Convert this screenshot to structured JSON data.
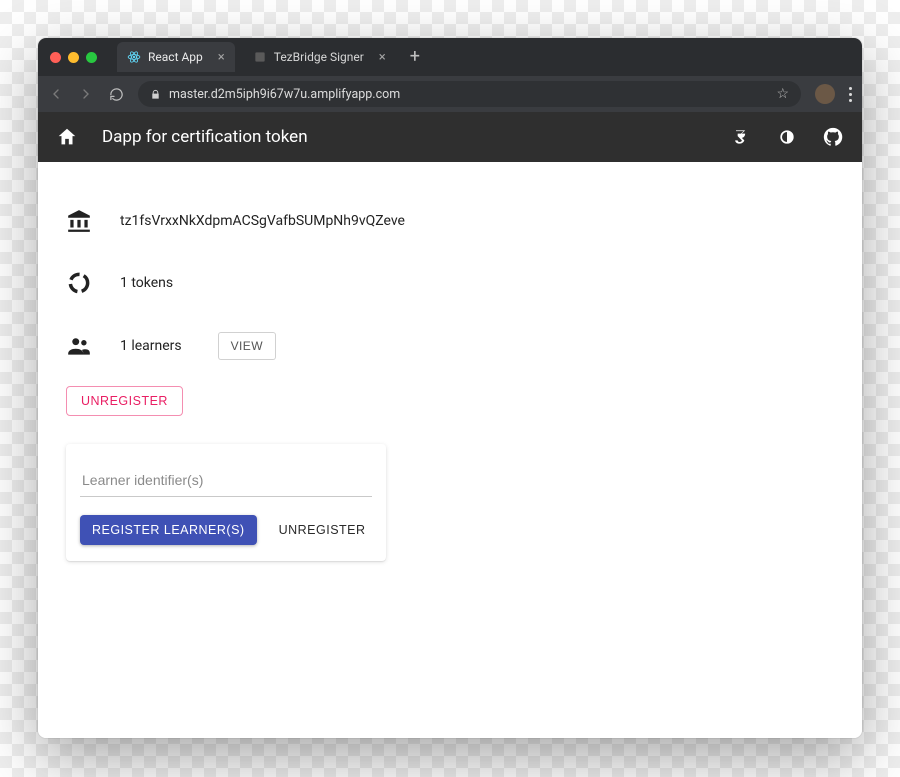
{
  "browser": {
    "tabs": [
      {
        "label": "React App",
        "active": true
      },
      {
        "label": "TezBridge Signer",
        "active": false
      }
    ],
    "url": "master.d2m5iph9i67w7u.amplifyapp.com"
  },
  "appbar": {
    "title": "Dapp for certification token"
  },
  "account": {
    "address": "tz1fsVrxxNkXdpmACSgVafbSUMpNh9vQZeve",
    "tokens_label": "1 tokens",
    "learners_label": "1 learners"
  },
  "buttons": {
    "view": "VIEW",
    "unregister_outline": "UNREGISTER",
    "register_primary": "REGISTER LEARNER(S)",
    "unregister_flat": "UNREGISTER"
  },
  "form": {
    "learner_placeholder": "Learner identifier(s)",
    "learner_value": ""
  }
}
